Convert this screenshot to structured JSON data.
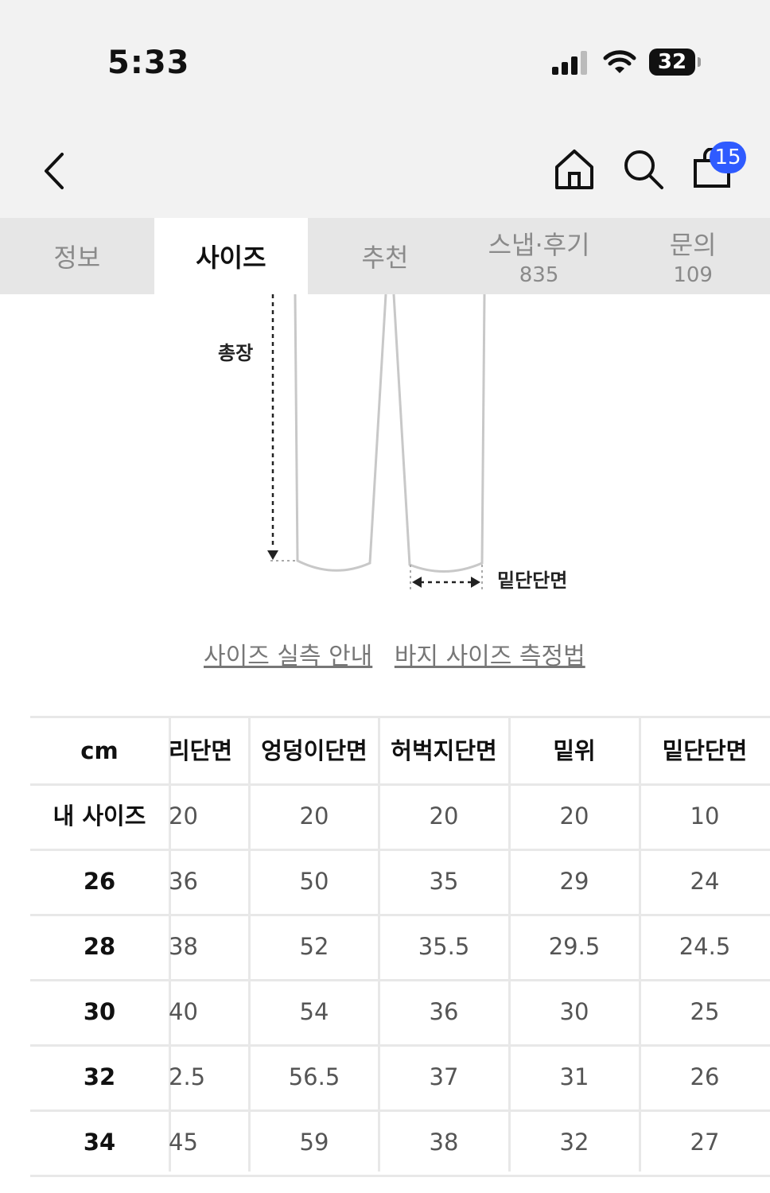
{
  "status": {
    "time": "5:33",
    "battery": "32"
  },
  "nav": {
    "cart_count": "15"
  },
  "tabs": [
    {
      "label": "정보",
      "count": ""
    },
    {
      "label": "사이즈",
      "count": ""
    },
    {
      "label": "추천",
      "count": ""
    },
    {
      "label": "스냅·후기",
      "count": "835"
    },
    {
      "label": "문의",
      "count": "109"
    }
  ],
  "diagram": {
    "length_label": "총장",
    "hem_label": "밑단단면"
  },
  "links": {
    "size_guide": "사이즈 실측 안내",
    "pants_measure": "바지 사이즈 측정법"
  },
  "table": {
    "unit": "cm",
    "headers": [
      "리단면",
      "엉덩이단면",
      "허벅지단면",
      "밑위",
      "밑단단면"
    ],
    "rows": [
      {
        "label": "내 사이즈",
        "values": [
          "20",
          "20",
          "20",
          "20",
          "10"
        ]
      },
      {
        "label": "26",
        "values": [
          "36",
          "50",
          "35",
          "29",
          "24"
        ]
      },
      {
        "label": "28",
        "values": [
          "38",
          "52",
          "35.5",
          "29.5",
          "24.5"
        ]
      },
      {
        "label": "30",
        "values": [
          "40",
          "54",
          "36",
          "30",
          "25"
        ]
      },
      {
        "label": "32",
        "values": [
          "2.5",
          "56.5",
          "37",
          "31",
          "26"
        ]
      },
      {
        "label": "34",
        "values": [
          "45",
          "59",
          "38",
          "32",
          "27"
        ]
      }
    ]
  }
}
